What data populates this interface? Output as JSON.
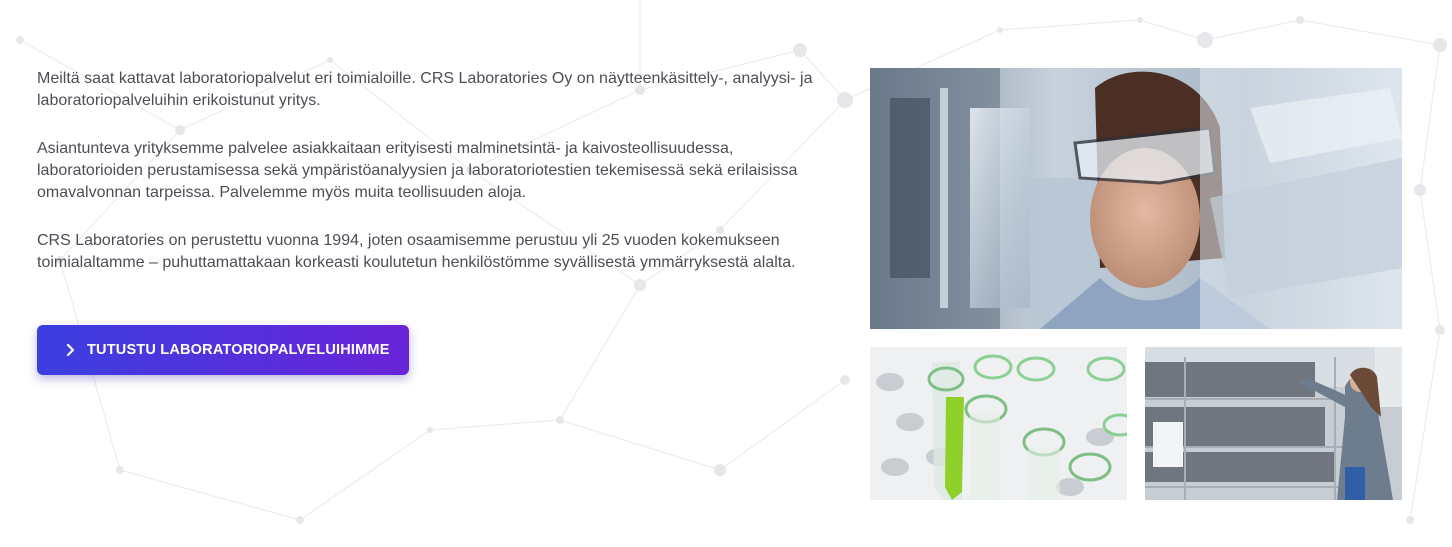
{
  "intro": {
    "paragraphs": [
      "Meiltä saat kattavat laboratoriopalvelut eri toimialoille. CRS Laboratories Oy on näytteenkäsittely-, analyysi- ja laboratoriopalveluihin erikoistunut yritys.",
      "Asiantunteva yrityksemme palvelee asiakkaitaan erityisesti malminetsintä- ja kaivosteollisuudessa, laboratorioiden perustamisessa sekä ympäristöanalyysien ja laboratoriotestien tekemisessä sekä erilaisissa omavalvonnan tarpeissa. Palvelemme myös muita teollisuuden aloja.",
      "CRS Laboratories on perustettu vuonna 1994, joten osaamisemme perustuu yli 25 vuoden kokemukseen toimialaltamme – puhuttamattakaan korkeasti koulutetun henkilöstömme syvällisestä ymmärryksestä alalta."
    ]
  },
  "cta": {
    "label": "TUTUSTU LABORATORIOPALVELUIHIMME",
    "icon": "chevron-right-icon",
    "gradient_start": "#3b3fe0",
    "gradient_end": "#6a24d8"
  },
  "images": [
    {
      "name": "lab-scientist-photo",
      "subject": "scientist with safety goggles"
    },
    {
      "name": "test-tubes-photo",
      "subject": "test tubes, one green"
    },
    {
      "name": "sample-shelves-photo",
      "subject": "worker at sample shelves"
    }
  ]
}
